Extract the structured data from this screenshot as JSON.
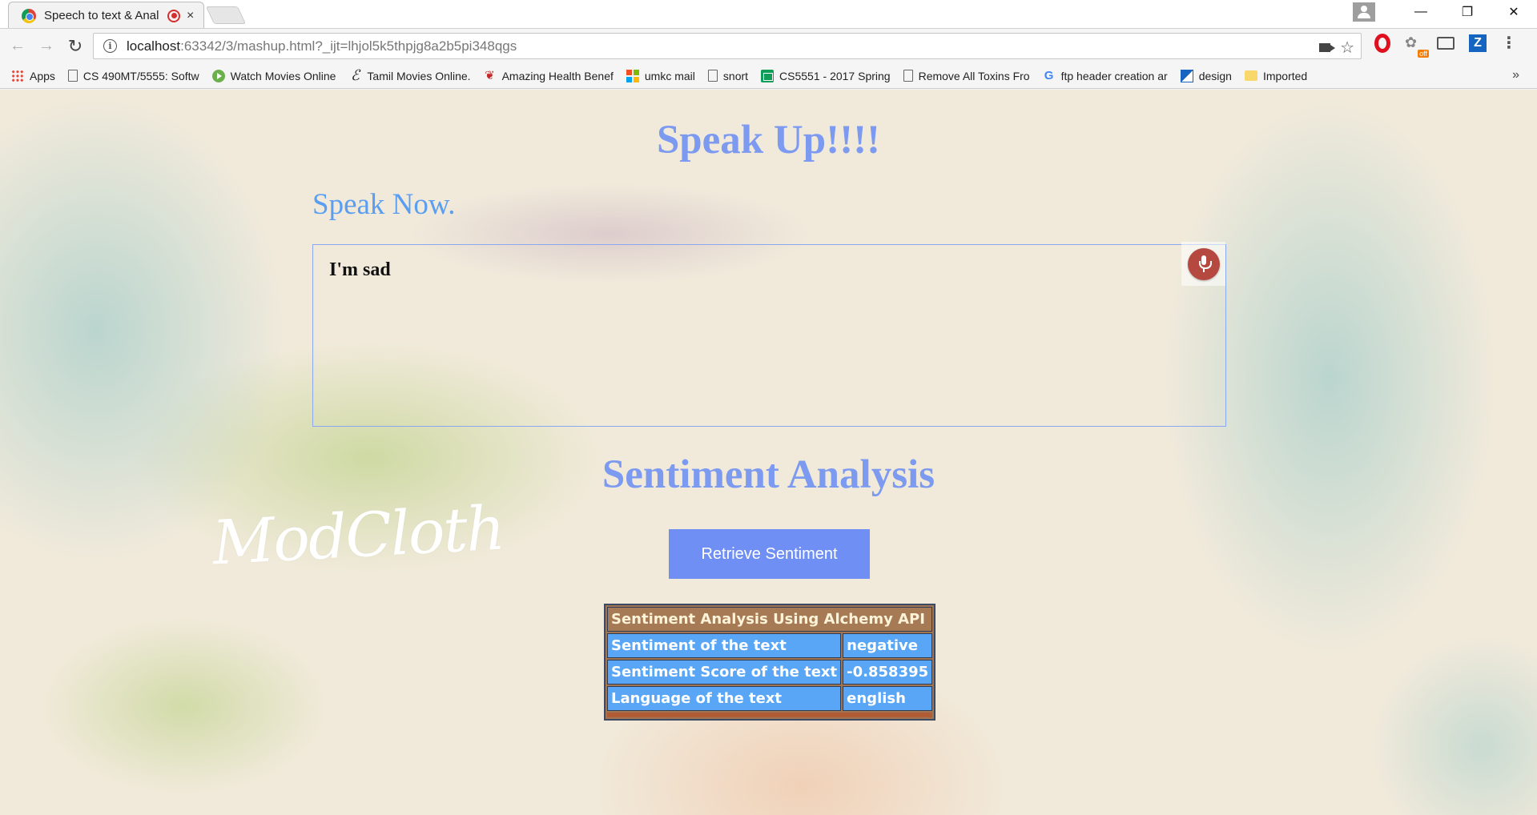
{
  "browser": {
    "tab_title": "Speech to text & Anal",
    "tab_close": "×",
    "url_host": "localhost",
    "url_rest": ":63342/3/mashup.html?_ijt=lhjol5k5thpjg8a2b5pi348qgs",
    "window_controls": {
      "minimize": "—",
      "restore": "❐",
      "close": "✕"
    },
    "extension_badge": "off",
    "bookmarks": [
      {
        "label": "Apps",
        "icon": "apps-icon"
      },
      {
        "label": "CS 490MT/5555: Softw",
        "icon": "page-icon"
      },
      {
        "label": "Watch Movies Online",
        "icon": "play-icon"
      },
      {
        "label": "Tamil Movies Online.",
        "icon": "e-icon"
      },
      {
        "label": "Amazing Health Benef",
        "icon": "heart-icon"
      },
      {
        "label": "umkc mail",
        "icon": "microsoft-icon"
      },
      {
        "label": "snort",
        "icon": "page-icon"
      },
      {
        "label": "CS5551 - 2017 Spring",
        "icon": "sheets-icon"
      },
      {
        "label": "Remove All Toxins Fro",
        "icon": "page-icon"
      },
      {
        "label": "ftp header creation ar",
        "icon": "google-icon"
      },
      {
        "label": "design",
        "icon": "design-icon"
      },
      {
        "label": "Imported",
        "icon": "folder-icon"
      }
    ],
    "bookmarks_more": "»"
  },
  "page": {
    "title": "Speak Up!!!!",
    "speak_label": "Speak Now.",
    "speech_text": "I'm sad",
    "sentiment_heading": "Sentiment Analysis",
    "logo_text": "ModCloth",
    "retrieve_button": "Retrieve Sentiment",
    "table": {
      "header": "Sentiment Analysis Using Alchemy API",
      "rows": [
        {
          "label": "Sentiment of the text",
          "value": "negative"
        },
        {
          "label": "Sentiment Score of the text",
          "value": "-0.858395"
        },
        {
          "label": "Language of the text",
          "value": "english"
        }
      ]
    }
  },
  "colors": {
    "heading": "#7c9af0",
    "speak_label": "#5a9ef2",
    "button": "#6f8ff5",
    "table_cell": "#5aa6f6",
    "table_header": "#a57a55",
    "mic": "#b5483f"
  }
}
